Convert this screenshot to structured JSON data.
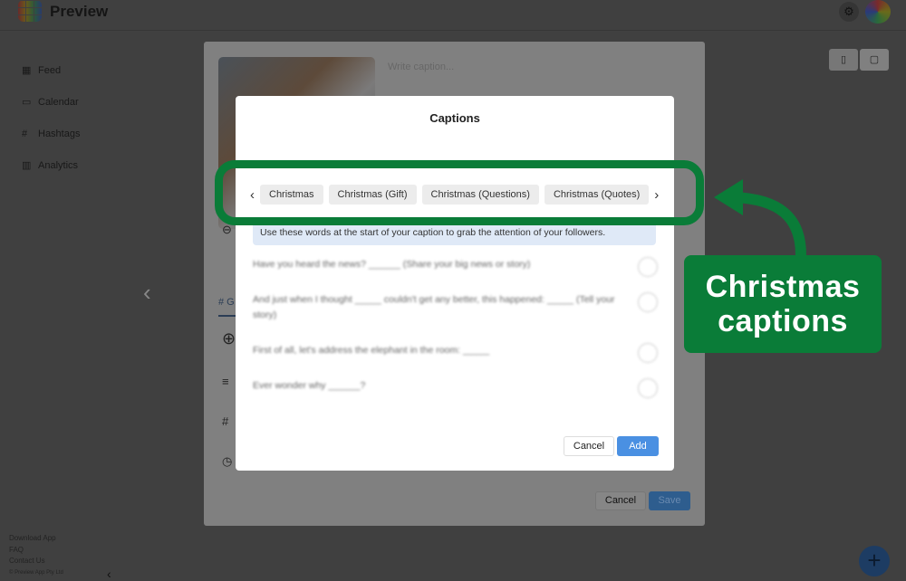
{
  "app": {
    "title": "Preview"
  },
  "sidebar": {
    "items": [
      {
        "icon": "grid-icon",
        "glyph": "▦",
        "label": "Feed"
      },
      {
        "icon": "calendar-icon",
        "glyph": "▭",
        "label": "Calendar"
      },
      {
        "icon": "hashtag-icon",
        "glyph": "#",
        "label": "Hashtags"
      },
      {
        "icon": "chart-icon",
        "glyph": "▥",
        "label": "Analytics"
      }
    ],
    "footer": [
      "Download App",
      "FAQ",
      "Contact Us"
    ],
    "copyright": "© Preview App Pty Ltd"
  },
  "post_editor": {
    "caption_placeholder": "Write caption...",
    "tab_label": "# G",
    "cancel": "Cancel",
    "save": "Save"
  },
  "captions_dialog": {
    "title": "Captions",
    "categories": [
      "Christmas",
      "Christmas (Gift)",
      "Christmas (Questions)",
      "Christmas (Quotes)"
    ],
    "info": "Use these words at the start of your caption to grab the attention of your followers.",
    "captions": [
      "Have you heard the news? ______ (Share your big news or story)",
      "And just when I thought _____ couldn't get any better, this happened: _____ (Tell your story)",
      "First of all, let's address the elephant in the room: _____",
      "Ever wonder why ______?"
    ],
    "cancel": "Cancel",
    "add": "Add"
  },
  "annotation": {
    "line1": "Christmas",
    "line2": "captions",
    "color": "#0a7c38"
  },
  "colors": {
    "accent": "#4a90e2",
    "info_bg": "#dfe9f7"
  }
}
